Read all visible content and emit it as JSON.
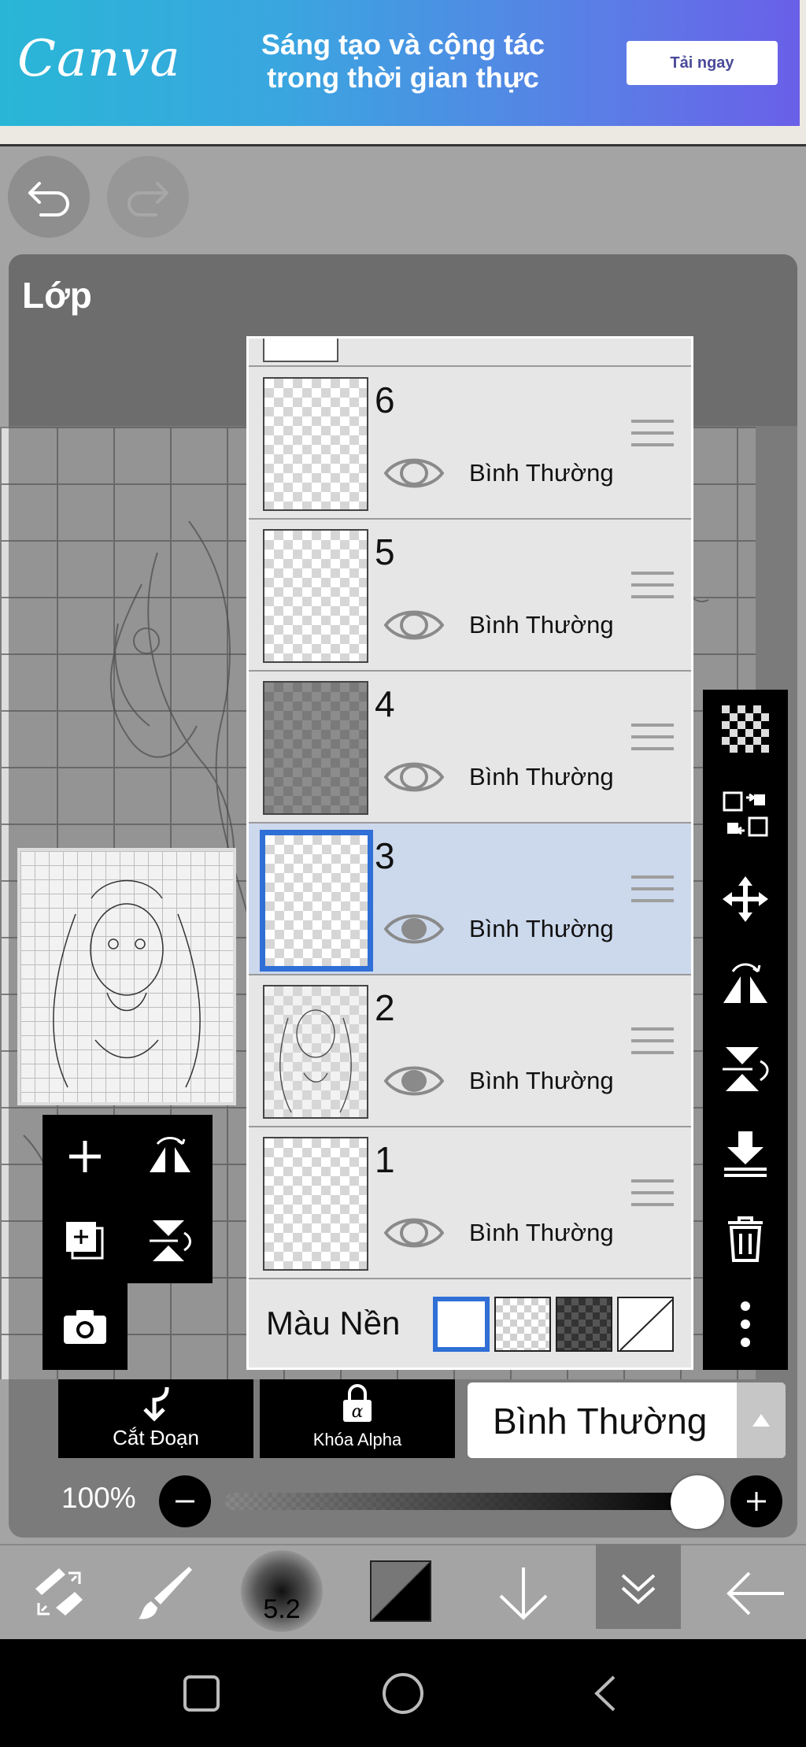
{
  "ad": {
    "logo": "Canva",
    "headline_line1": "Sáng tạo và cộng tác",
    "headline_line2": "trong thời gian thực",
    "cta": "Tải ngay"
  },
  "panel": {
    "title": "Lớp"
  },
  "layers": [
    {
      "number": "6",
      "mode": "Bình Thường",
      "visible": true,
      "selected": false,
      "thumb": "empty"
    },
    {
      "number": "5",
      "mode": "Bình Thường",
      "visible": true,
      "selected": false,
      "thumb": "empty"
    },
    {
      "number": "4",
      "mode": "Bình Thường",
      "visible": true,
      "selected": false,
      "thumb": "dark"
    },
    {
      "number": "3",
      "mode": "Bình Thường",
      "visible": true,
      "selected": true,
      "thumb": "empty"
    },
    {
      "number": "2",
      "mode": "Bình Thường",
      "visible": true,
      "selected": false,
      "thumb": "sketch"
    },
    {
      "number": "1",
      "mode": "Bình Thường",
      "visible": true,
      "selected": false,
      "thumb": "empty"
    }
  ],
  "background": {
    "label": "Màu Nền",
    "selected": "white"
  },
  "actions": {
    "clipping": "Cắt Đoạn",
    "alpha_lock": "Khóa Alpha",
    "blend_mode": "Bình Thường"
  },
  "opacity": {
    "label": "100%",
    "value": 1.0
  },
  "brush": {
    "size": "5.2"
  },
  "colors": {
    "selected": "#2f6fd6",
    "panel_bg": "#a4a4a4"
  }
}
